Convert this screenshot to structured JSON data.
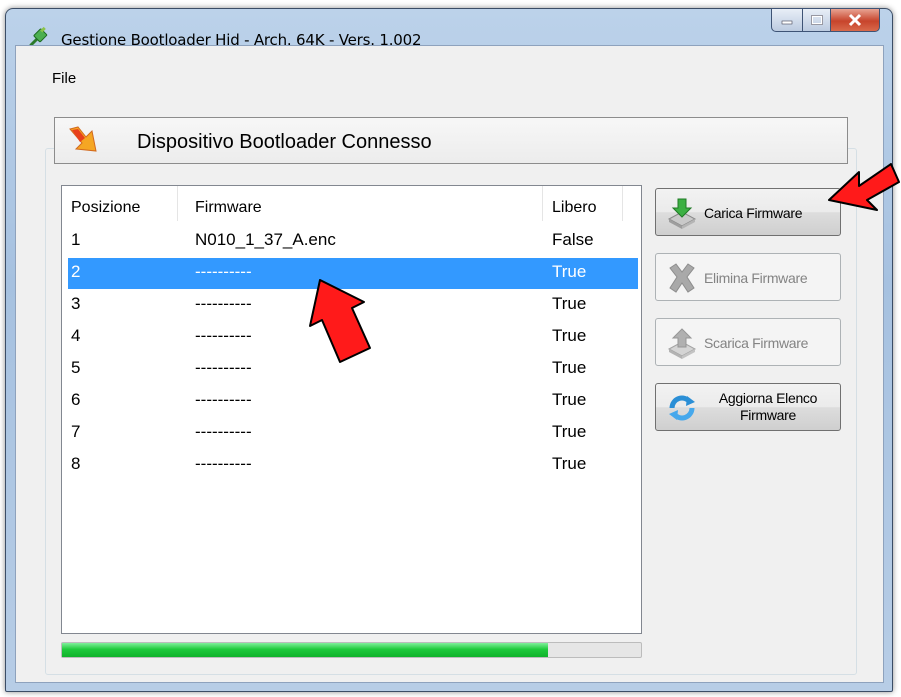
{
  "window": {
    "title": "Gestione Bootloader Hid - Arch. 64K - Vers. 1.002"
  },
  "menu": {
    "file_label": "File"
  },
  "header": {
    "title": "Dispositivo Bootloader Connesso"
  },
  "list": {
    "columns": [
      "Posizione",
      "Firmware",
      "Libero"
    ],
    "rows": [
      {
        "pos": "1",
        "firmware": "N010_1_37_A.enc",
        "free": "False"
      },
      {
        "pos": "2",
        "firmware": "----------",
        "free": "True"
      },
      {
        "pos": "3",
        "firmware": "----------",
        "free": "True"
      },
      {
        "pos": "4",
        "firmware": "----------",
        "free": "True"
      },
      {
        "pos": "5",
        "firmware": "----------",
        "free": "True"
      },
      {
        "pos": "6",
        "firmware": "----------",
        "free": "True"
      },
      {
        "pos": "7",
        "firmware": "----------",
        "free": "True"
      },
      {
        "pos": "8",
        "firmware": "----------",
        "free": "True"
      }
    ],
    "selected_index": 1
  },
  "buttons": {
    "load": "Carica Firmware",
    "delete": "Elimina Firmware",
    "download": "Scarica Firmware",
    "refresh": "Aggiorna Elenco Firmware"
  },
  "progress": {
    "fraction": 0.84
  },
  "colors": {
    "selection": "#3399ff",
    "progress": "#1fca3c",
    "annotation_arrow": "#ff0000"
  },
  "icons": {
    "app": "usb-plug-icon",
    "header": "orange-arrow-icon",
    "load": "download-green-icon",
    "delete": "delete-x-icon",
    "download": "download-gray-icon",
    "refresh": "refresh-icon"
  }
}
